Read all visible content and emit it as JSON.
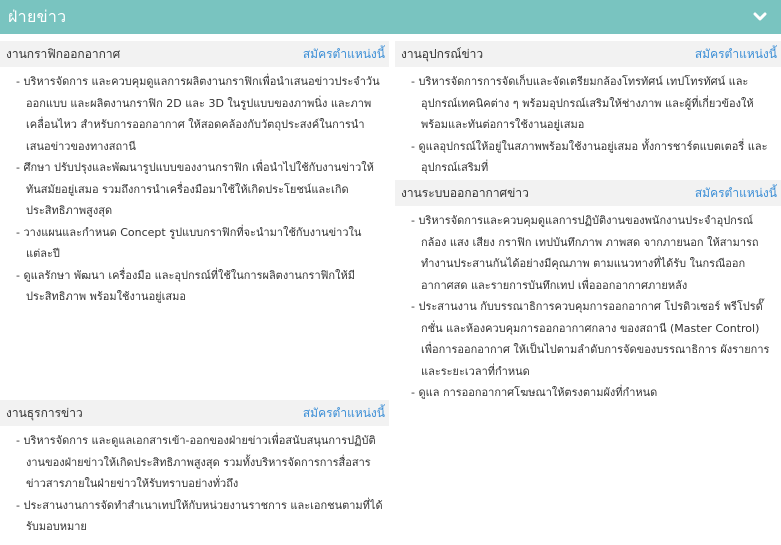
{
  "header": {
    "title": "ฝ่ายข่าว",
    "toggle_icon": "chevron-down-icon"
  },
  "colors": {
    "header_bg": "#79c4c0",
    "card_head_bg": "#f2f2f2",
    "link": "#3b8ed6"
  },
  "cards": [
    {
      "title": "งานกราฟิกออกอากาศ",
      "apply_label": "สมัครตำแหน่งนี้",
      "items": [
        "บริหารจัดการ และควบคุมดูแลการผลิตงานกราฟิกเพื่อนำเสนอข่าวประจำวัน ออกแบบ และผลิตงานกราฟิก 2D และ 3D ในรูปแบบของภาพนิ่ง และภาพเคลื่อนไหว สำหรับการออกอากาศ ให้สอดคล้องกับวัตถุประสงค์ในการนำเสนอข่าวของทางสถานี",
        "ศึกษา ปรับปรุงและพัฒนารูปแบบของงานกราฟิก เพื่อนำไปใช้กับงานข่าวให้ทันสมัยอยู่เสมอ รวมถึงการนำเครื่องมือมาใช้ให้เกิดประโยชน์และเกิดประสิทธิภาพสูงสุด",
        "วางแผนและกำหนด Concept รูปแบบกราฟิกที่จะนำมาใช้กับงานข่าวในแต่ละปี",
        "ดูแลรักษา พัฒนา เครื่องมือ และอุปกรณ์ที่ใช้ในการผลิตงานกราฟิกให้มีประสิทธิภาพ พร้อมใช้งานอยู่เสมอ"
      ]
    },
    {
      "title": "งานอุปกรณ์ข่าว",
      "apply_label": "สมัครตำแหน่งนี้",
      "items": [
        "บริหารจัดการการจัดเก็บและจัดเตรียมกล้องโทรทัศน์ เทปโทรทัศน์ และอุปกรณ์เทคนิคต่าง ๆ พร้อมอุปกรณ์เสริมให้ช่างภาพ และผู้ที่เกี่ยวข้องให้พร้อมและทันต่อการใช้งานอยู่เสมอ",
        "ดูแลอุปกรณ์ให้อยู่ในสภาพพร้อมใช้งานอยู่เสมอ ทั้งการชาร์ตแบตเตอรี่ และอุปกรณ์เสริมที่"
      ]
    },
    {
      "title": "งานระบบออกอากาศข่าว",
      "apply_label": "สมัครตำแหน่งนี้",
      "items": [
        "บริหารจัดการและควบคุมดูแลการปฏิบัติงานของพนักงานประจำอุปกรณ์ กล้อง แสง เสียง กราฟิก เทปบันทึกภาพ ภาพสด จากภายนอก ให้สามารถทำงานประสานกันได้อย่างมีคุณภาพ ตามแนวทางที่ได้รับ ในกรณีออกอากาศสด และรายการบันทึกเทป เพื่อออกอากาศภายหลัง",
        "ประสานงาน กับบรรณาธิการควบคุมการออกอากาศ โปรดิวเซอร์ พรีโปรดั๊กชั่น และห้องควบคุมการออกอากาศกลาง ของสถานี (Master Control) เพื่อการออกอากาศ ให้เป็นไปตามลำดับการจัดของบรรณาธิการ ผังรายการ และระยะเวลาที่กำหนด",
        "ดูแล การออกอากาศโฆษณาให้ตรงตามผังที่กำหนด"
      ]
    },
    {
      "title": "งานธุรการข่าว",
      "apply_label": "สมัครตำแหน่งนี้",
      "items": [
        "บริหารจัดการ และดูแลเอกสารเข้า-ออกของฝ่ายข่าวเพื่อสนับสนุนการปฏิบัติงานของฝ่ายข่าวให้เกิดประสิทธิภาพสูงสุด รวมทั้งบริหารจัดการการสื่อสารข่าวสารภายในฝ่ายข่าวให้รับทราบอย่างทั่วถึง",
        "ประสานงานการจัดทำสำเนาเทปให้กับหน่วยงานราชการ และเอกชนตามที่ได้รับมอบหมาย"
      ]
    }
  ]
}
